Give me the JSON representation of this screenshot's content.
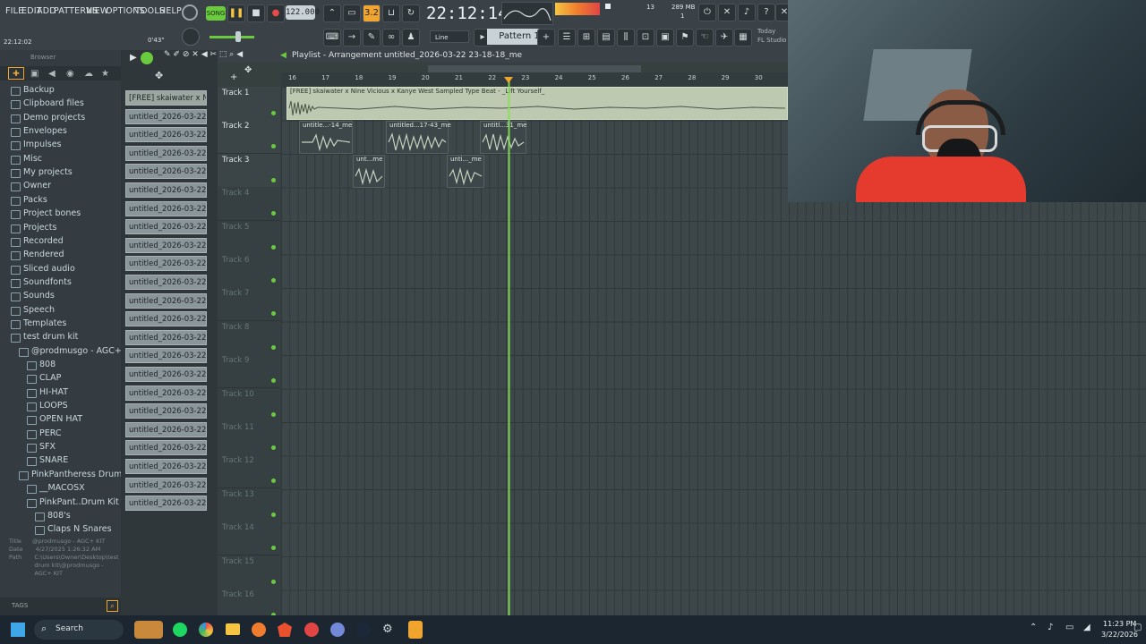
{
  "menu": [
    "FILE",
    "EDIT",
    "ADD",
    "PATTERNS",
    "VIEW",
    "OPTIONS",
    "TOOLS",
    "HELP"
  ],
  "transport": {
    "mode": "SONG",
    "tempo": "122.000",
    "time": "22:12:14",
    "time_small": "22:12:02",
    "time_small2": "0'43\"",
    "memory": "289 MB",
    "cpu": "13",
    "voices": "1",
    "step": "3.2"
  },
  "snap": "Line",
  "pattern": "Pattern 1",
  "hint": {
    "today": "Today",
    "app": "FL Studio"
  },
  "browser": {
    "title": "Browser",
    "tags": "TAGS",
    "items": [
      {
        "label": "Backup",
        "level": 0
      },
      {
        "label": "Clipboard files",
        "level": 0
      },
      {
        "label": "Demo projects",
        "level": 0
      },
      {
        "label": "Envelopes",
        "level": 0
      },
      {
        "label": "Impulses",
        "level": 0
      },
      {
        "label": "Misc",
        "level": 0
      },
      {
        "label": "My projects",
        "level": 0
      },
      {
        "label": "Owner",
        "level": 0
      },
      {
        "label": "Packs",
        "level": 0
      },
      {
        "label": "Project bones",
        "level": 0
      },
      {
        "label": "Projects",
        "level": 0
      },
      {
        "label": "Recorded",
        "level": 0
      },
      {
        "label": "Rendered",
        "level": 0
      },
      {
        "label": "Sliced audio",
        "level": 0
      },
      {
        "label": "Soundfonts",
        "level": 0
      },
      {
        "label": "Sounds",
        "level": 0
      },
      {
        "label": "Speech",
        "level": 0
      },
      {
        "label": "Templates",
        "level": 0
      },
      {
        "label": "test drum kit",
        "level": 0
      },
      {
        "label": "@prodmusgo - AGC+ KIT",
        "level": 1
      },
      {
        "label": "808",
        "level": 2
      },
      {
        "label": "CLAP",
        "level": 2
      },
      {
        "label": "HI-HAT",
        "level": 2
      },
      {
        "label": "LOOPS",
        "level": 2
      },
      {
        "label": "OPEN HAT",
        "level": 2
      },
      {
        "label": "PERC",
        "level": 2
      },
      {
        "label": "SFX",
        "level": 2
      },
      {
        "label": "SNARE",
        "level": 2
      },
      {
        "label": "PinkPantheress Drum Kit",
        "level": 1
      },
      {
        "label": "__MACOSX",
        "level": 2
      },
      {
        "label": "PinkPant..Drum Kit",
        "level": 2
      },
      {
        "label": "808's",
        "level": 3
      },
      {
        "label": "Claps N Snares",
        "level": 3
      }
    ],
    "info": {
      "title_label": "Title",
      "title_val": "@prodmusgo - AGC+ KIT",
      "date_label": "Date",
      "date_val": "4/27/2025 1:26:32 AM",
      "path_label": "Path",
      "path_val": "C:\\Users\\Owner\\Desktop\\test drum kit\\@prodmusgo - AGC+ KIT"
    }
  },
  "picker": [
    "[FREE] skaiwater x Ni..",
    "untitled_2026-03-22 23-",
    "untitled_2026-03-22 23-",
    "untitled_2026-03-22 23-",
    "untitled_2026-03-22 23-",
    "untitled_2026-03-22 23-",
    "untitled_2026-03-22 23-",
    "untitled_2026-03-22 23-",
    "untitled_2026-03-22 23-",
    "untitled_2026-03-22 23-",
    "untitled_2026-03-22 23-",
    "untitled_2026-03-22 23-",
    "untitled_2026-03-22 23-",
    "untitled_2026-03-22 23-",
    "untitled_2026-03-22 23-",
    "untitled_2026-03-22 23-",
    "untitled_2026-03-22 23-",
    "untitled_2026-03-22 23-",
    "untitled_2026-03-22 23-",
    "untitled_2026-03-22 23-",
    "untitled_2026-03-22 23-",
    "untitled_2026-03-22 23-",
    "untitled_2026-03-22 23-"
  ],
  "playlist": {
    "title": "Playlist - Arrangement",
    "file": "untitled_2026-03-22 23-18-18_me",
    "bars": [
      "16",
      "17",
      "18",
      "19",
      "20",
      "21",
      "22",
      "23",
      "24",
      "25",
      "26",
      "27",
      "28",
      "29",
      "30"
    ],
    "tracks": [
      "Track 1",
      "Track 2",
      "Track 3",
      "Track 4",
      "Track 5",
      "Track 6",
      "Track 7",
      "Track 8",
      "Track 9",
      "Track 10",
      "Track 11",
      "Track 12",
      "Track 13",
      "Track 14",
      "Track 15",
      "Track 16"
    ],
    "clips": [
      {
        "label": "[FREE] skaiwater x Nine Vicious x Kanye West Sampled Type Beat - _Lift Yourself_",
        "track": 0
      },
      {
        "label": "untitle...-14_me",
        "track": 1
      },
      {
        "label": "untitled...17-43_me",
        "track": 1
      },
      {
        "label": "untitl...31_me",
        "track": 1
      },
      {
        "label": "unt...me",
        "track": 2
      },
      {
        "label": "unti..._me",
        "track": 2
      }
    ]
  },
  "taskbar": {
    "search": "Search",
    "clock": "11:23 PM",
    "date": "3/22/2026"
  }
}
